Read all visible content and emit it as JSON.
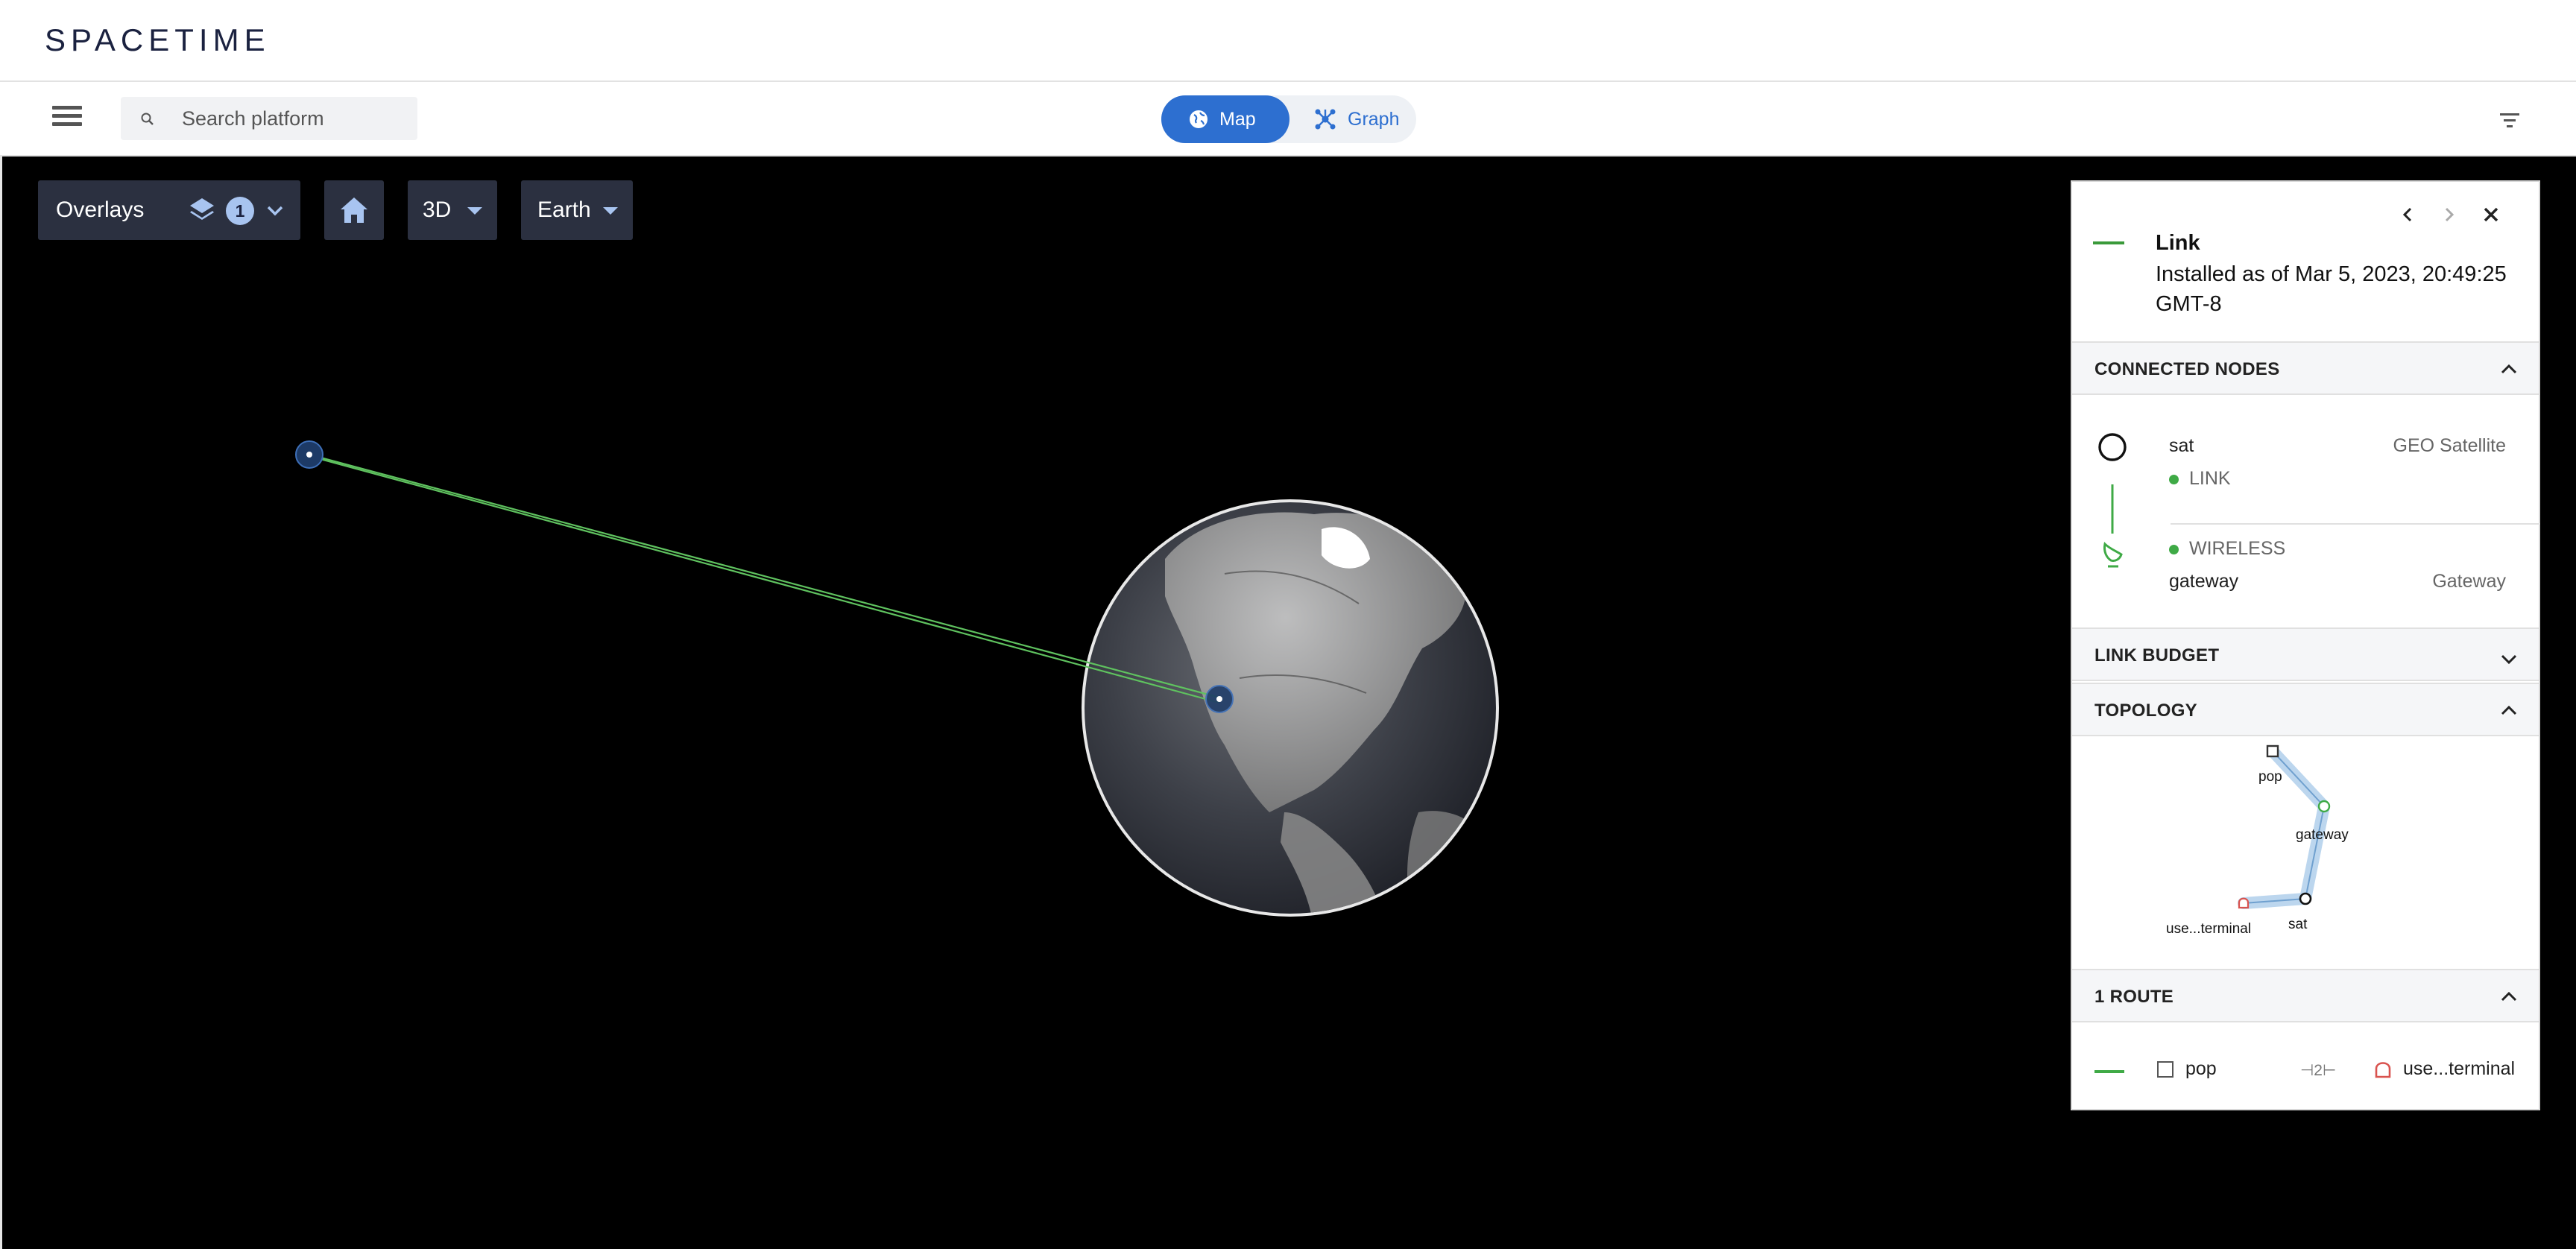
{
  "brand": {
    "logo_text": "SPACETIME"
  },
  "toolbar": {
    "search_placeholder": "Search platform",
    "view_toggle": {
      "map_label": "Map",
      "graph_label": "Graph",
      "active": "Map"
    }
  },
  "map_controls": {
    "overlays_label": "Overlays",
    "overlays_count": "1",
    "view_mode": "3D",
    "body": "Earth"
  },
  "details_panel": {
    "title": "Link",
    "subtitle": "Installed as of Mar 5, 2023, 20:49:25 GMT-8",
    "connected_nodes": {
      "header": "CONNECTED NODES",
      "node_a": {
        "name": "sat",
        "type": "GEO Satellite",
        "interface": "LINK"
      },
      "node_b": {
        "name": "gateway",
        "type": "Gateway",
        "interface": "WIRELESS"
      }
    },
    "link_budget_header": "LINK BUDGET",
    "topology": {
      "header": "TOPOLOGY",
      "labels": {
        "pop": "pop",
        "gateway": "gateway",
        "sat": "sat",
        "terminal": "use...terminal"
      }
    },
    "routes": {
      "header": "1 ROUTE",
      "from": "pop",
      "hops": "2",
      "to": "use...terminal"
    }
  },
  "colors": {
    "accent": "#2d6fd0",
    "link_green": "#3faa46",
    "control_bg": "#2b3040",
    "badge_bg": "#a8c4f0",
    "terminal_red": "#d9534f"
  }
}
